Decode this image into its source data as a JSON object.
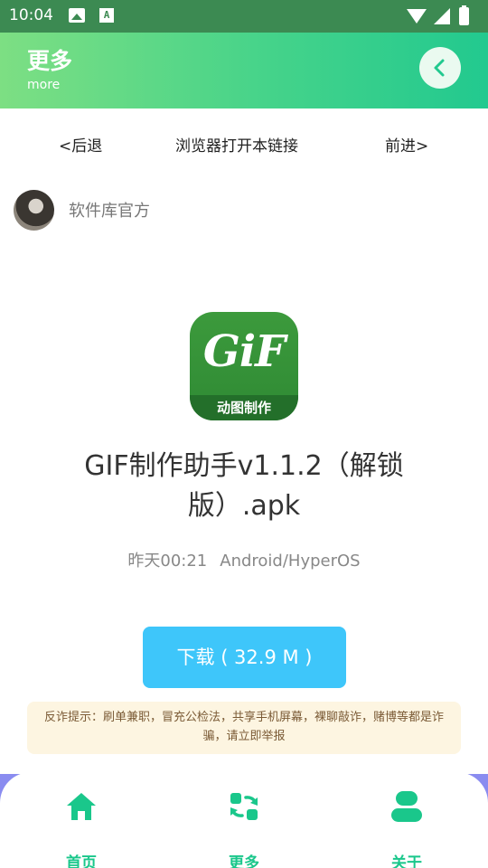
{
  "status_bar": {
    "time": "10:04"
  },
  "header": {
    "title": "更多",
    "subtitle": "more"
  },
  "browser_nav": {
    "back": "<后退",
    "open_in_browser": "浏览器打开本链接",
    "forward": "前进>"
  },
  "author": {
    "name": "软件库官方"
  },
  "app": {
    "icon_text": "GiF",
    "icon_label": "动图制作",
    "title": "GIF制作助手v1.1.2（解锁版）.apk",
    "date": "昨天00:21",
    "platform": "Android/HyperOS",
    "download_label": "下载 ( 32.9 M )"
  },
  "warning": "反诈提示：刷单兼职，冒充公检法，共享手机屏幕，裸聊敲诈，赌博等都是诈骗，请立即举报",
  "bottom_nav": [
    {
      "label": "首页",
      "icon": "home-icon"
    },
    {
      "label": "更多",
      "icon": "refresh-grid-icon"
    },
    {
      "label": "关于",
      "icon": "user-icon"
    }
  ],
  "colors": {
    "accent": "#1ac78b",
    "download": "#3ec6fa",
    "header_start": "#7ddf83",
    "header_end": "#22c98f",
    "warning_bg": "#fdf5e1"
  }
}
